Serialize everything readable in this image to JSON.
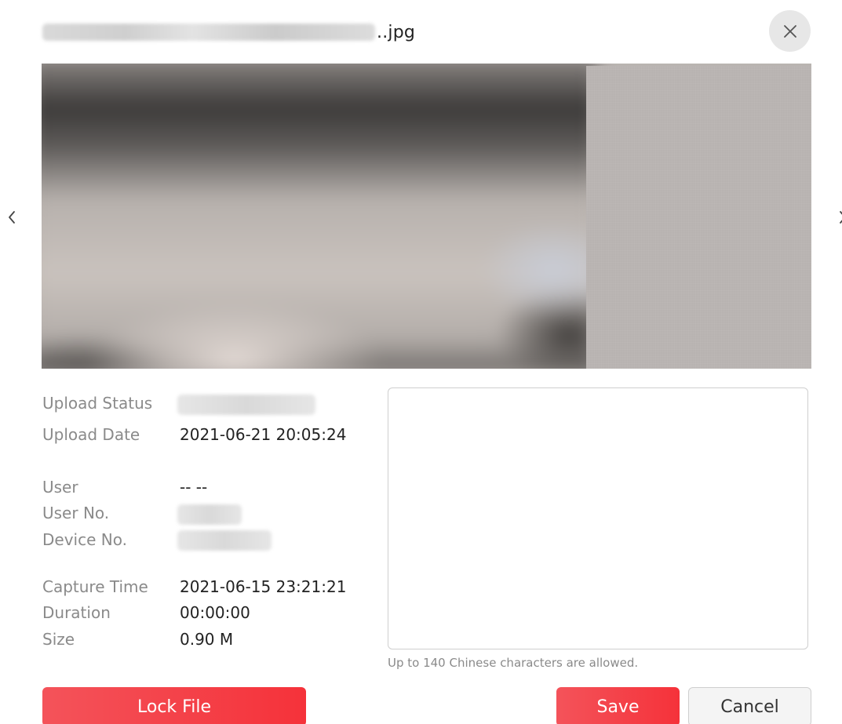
{
  "title": {
    "filename_suffix": "..jpg"
  },
  "controls": {
    "close_icon": "close-icon",
    "prev_icon": "chevron-left-icon",
    "next_icon": "chevron-right-icon"
  },
  "info": {
    "upload_status": {
      "label": "Upload Status"
    },
    "upload_date": {
      "label": "Upload Date",
      "value": "2021-06-21 20:05:24"
    },
    "user": {
      "label": "User",
      "value": "-- --"
    },
    "user_no": {
      "label": "User No."
    },
    "device_no": {
      "label": "Device No."
    },
    "capture_time": {
      "label": "Capture Time",
      "value": "2021-06-15 23:21:21"
    },
    "duration": {
      "label": "Duration",
      "value": "00:00:00"
    },
    "size": {
      "label": "Size",
      "value": "0.90 M"
    }
  },
  "remarks": {
    "value": "",
    "hint": "Up to 140 Chinese characters are allowed."
  },
  "buttons": {
    "lock_file": "Lock File",
    "save": "Save",
    "cancel": "Cancel"
  },
  "colors": {
    "accent_red": "#f5323a",
    "label_gray": "#8a8a8a",
    "close_bg": "#e7e7e7"
  }
}
